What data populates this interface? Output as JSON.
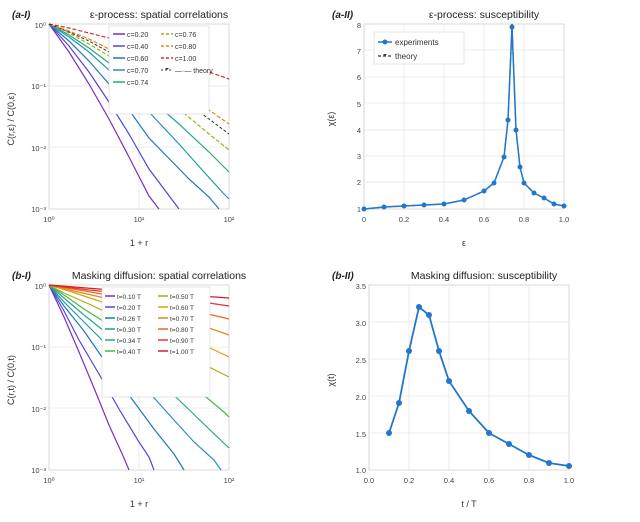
{
  "panels": {
    "aI": {
      "label": "(a-I)",
      "title": "ε-process: spatial correlations",
      "xaxis": "1 + r",
      "yaxis": "C(r,ε) / C(0,ε)",
      "legend": [
        {
          "c": "0.20",
          "color": "#7b2fbe"
        },
        {
          "c": "0.40",
          "color": "#4444cc"
        },
        {
          "c": "0.60",
          "color": "#2277bb"
        },
        {
          "c": "0.70",
          "color": "#2299aa"
        },
        {
          "c": "0.74",
          "color": "#22aa88"
        },
        {
          "c": "0.76",
          "color": "#aaaa22"
        },
        {
          "c": "0.80",
          "color": "#dd8822"
        },
        {
          "c": "1.00",
          "color": "#cc3333"
        },
        {
          "c": "theory",
          "color": "#333333",
          "dashed": true
        }
      ]
    },
    "aII": {
      "label": "(a-II)",
      "title": "ε-process: susceptibility",
      "xaxis": "ε",
      "yaxis": "χ(ε)",
      "legend": [
        {
          "label": "experiments",
          "color": "#2277cc"
        },
        {
          "label": "theory",
          "color": "#333333",
          "dashed": true
        }
      ]
    },
    "bI": {
      "label": "(b-I)",
      "title": "Masking diffusion: spatial correlations",
      "xaxis": "1 + r",
      "yaxis": "C(r,t) / C(0,t)",
      "legend": [
        {
          "t": "0.10 T",
          "color": "#7b2fbe"
        },
        {
          "t": "0.20 T",
          "color": "#4444cc"
        },
        {
          "t": "0.26 T",
          "color": "#2277bb"
        },
        {
          "t": "0.30 T",
          "color": "#2299aa"
        },
        {
          "t": "0.34 T",
          "color": "#22aa88"
        },
        {
          "t": "0.40 T",
          "color": "#44bb44"
        },
        {
          "t": "0.50 T",
          "color": "#aaaa22"
        },
        {
          "t": "0.60 T",
          "color": "#ccaa00"
        },
        {
          "t": "0.70 T",
          "color": "#dd8822"
        },
        {
          "t": "0.80 T",
          "color": "#ee6622"
        },
        {
          "t": "0.90 T",
          "color": "#ee3333"
        },
        {
          "t": "1.00 T",
          "color": "#cc2222"
        }
      ]
    },
    "bII": {
      "label": "(b-II)",
      "title": "Masking diffusion: susceptibility",
      "xaxis": "t / T",
      "yaxis": "χ(t)"
    }
  }
}
